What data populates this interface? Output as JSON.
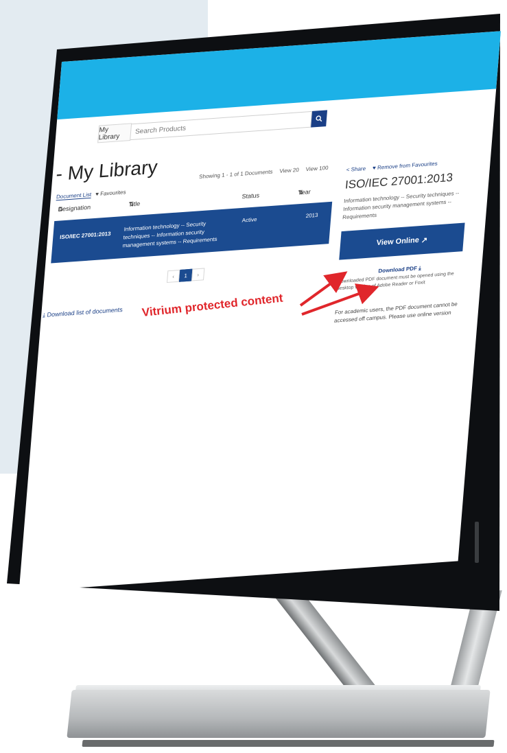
{
  "search": {
    "library_link": "My Library",
    "placeholder": "Search Products",
    "icon": "search-icon"
  },
  "page": {
    "title": "- My Library",
    "tabs": [
      "Document List",
      "Favourites"
    ],
    "showing": "Showing 1 - 1 of 1 Documents",
    "view20": "View 20",
    "view100": "View 100"
  },
  "table": {
    "headers": [
      "Designation",
      "Title",
      "Status",
      "Year"
    ],
    "rows": [
      {
        "designation": "ISO/IEC 27001:2013",
        "title": "Information technology -- Security techniques -- Information security management systems -- Requirements",
        "status": "Active",
        "year": "2013"
      }
    ]
  },
  "pager": {
    "prev": "‹",
    "current": "1",
    "next": "›"
  },
  "download_list": "Download list of documents",
  "detail": {
    "share": "Share",
    "remove_fav": "Remove from Favourites",
    "code": "ISO/IEC 27001:2013",
    "title": "Information technology -- Security techniques -- Information security management systems -- Requirements",
    "view_online": "View Online",
    "download_pdf": "Download PDF",
    "pdf_note": "Downloaded PDF document must be opened using the desktop version of Adobe Reader or Foxit",
    "academic_note": "For academic users, the PDF document cannot be accessed off campus. Please use online version"
  },
  "annotation": "Vitrium protected content",
  "colors": {
    "topbar": "#1cb1e7",
    "primary": "#1b4b90",
    "annotation": "#e0262b",
    "bezel": "#0d0f12",
    "background_panel": "#e3ebf1"
  }
}
